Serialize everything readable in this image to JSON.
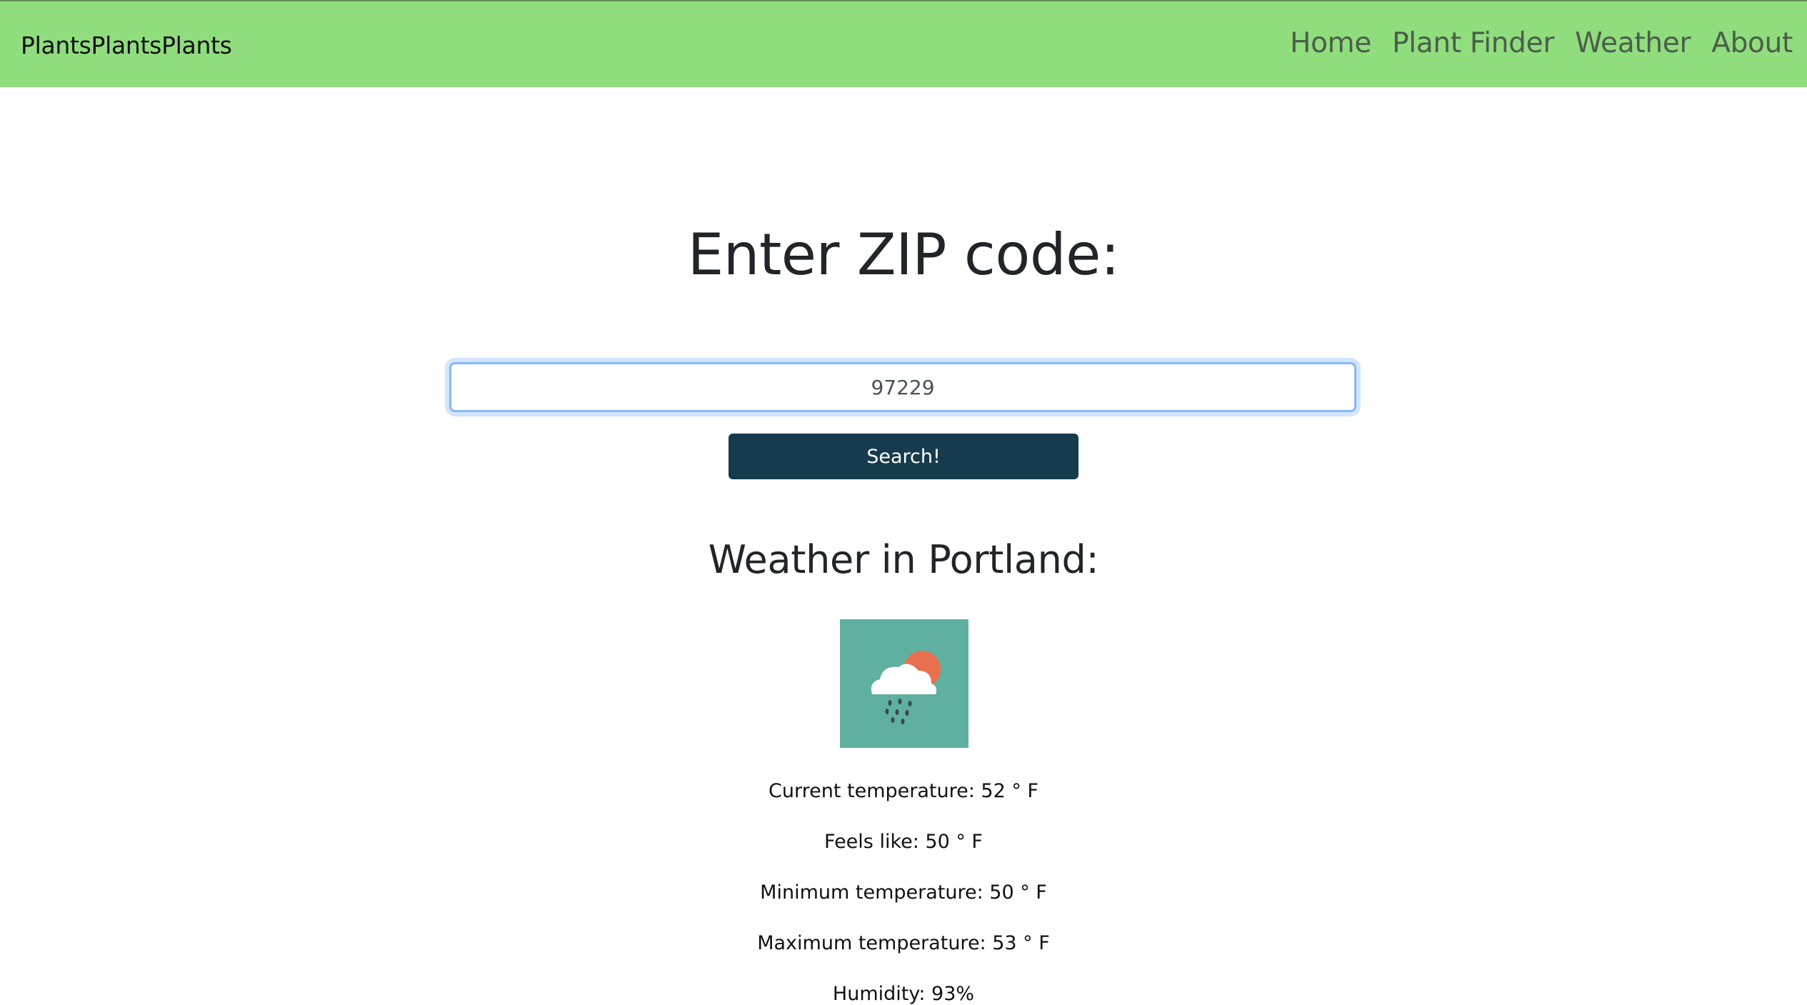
{
  "nav": {
    "brand": "PlantsPlantsPlants",
    "links": [
      "Home",
      "Plant Finder",
      "Weather",
      "About"
    ]
  },
  "search": {
    "title": "Enter ZIP code:",
    "zip_value": "97229",
    "button_label": "Search!"
  },
  "weather": {
    "heading": "Weather in Portland:",
    "icon": "rain-cloud-sun-icon",
    "stats": [
      "Current temperature: 52 ° F",
      "Feels like: 50 ° F",
      "Minimum temperature: 50 ° F",
      "Maximum temperature: 53 ° F",
      "Humidity: 93%"
    ]
  },
  "colors": {
    "navbar": "#90dd7e",
    "button": "#163b4c",
    "icon_bg": "#5fb0a0",
    "sun": "#e8704e"
  }
}
